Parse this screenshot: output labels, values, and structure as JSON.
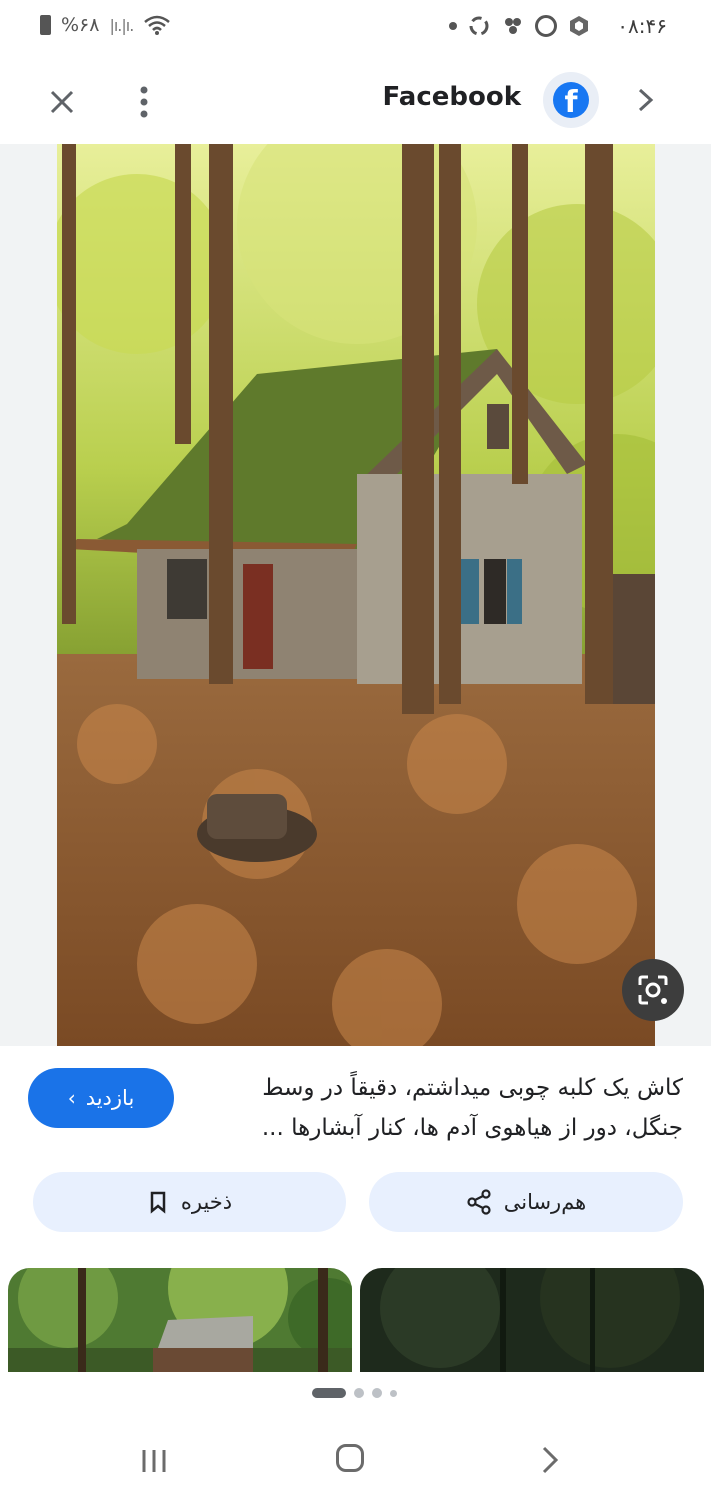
{
  "status_bar": {
    "time": "۰۸:۴۶",
    "battery": "%۶۸"
  },
  "top_bar": {
    "site_name": "Facebook",
    "site_icon": "facebook-logo",
    "close_icon": "close-icon",
    "more_icon": "more-vert-icon",
    "next_icon": "chevron-right-icon"
  },
  "main_image": {
    "lens_icon": "google-lens-icon"
  },
  "caption": {
    "text": "کاش یک کلبه چوبی میداشتم، دقیقاً در وسط جنگل، دور از هیاهوی آدم ها، کنار آبشارها ..."
  },
  "visit_button": {
    "label": "بازدید",
    "icon": "chevron-left-icon",
    "color": "#1a73e8"
  },
  "actions": {
    "save_label": "ذخیره",
    "save_icon": "bookmark-icon",
    "share_label": "هم‌رسانی",
    "share_icon": "share-icon"
  },
  "colors": {
    "accent": "#1a73e8",
    "facebook_blue": "#1877f2",
    "chip_bg": "#e8f0fe"
  }
}
